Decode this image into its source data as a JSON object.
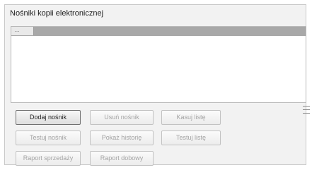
{
  "panel": {
    "title": "Nośniki kopii elektronicznej"
  },
  "buttons": {
    "add_medium": "Dodaj nośnik",
    "remove_medium": "Usuń nośnik",
    "erase_list": "Kasuj listę",
    "test_medium": "Testuj nośnik",
    "show_history": "Pokaż historię",
    "test_list": "Testuj listę",
    "sales_report": "Raport sprzedaży",
    "purchase_report": "Raport dobowy"
  },
  "icons": {
    "splitter": "splitter-grip-icon"
  }
}
